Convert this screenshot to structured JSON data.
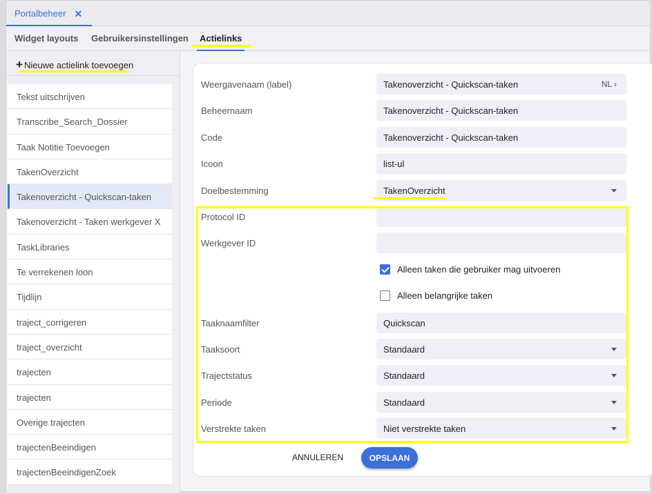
{
  "tab": {
    "title": "Portalbeheer",
    "close": "✕"
  },
  "subtabs": [
    "Widget layouts",
    "Gebruikersinstellingen",
    "Actielinks"
  ],
  "sidebar": {
    "add_label": "Nieuwe actielink toevoegen",
    "items": [
      "Tekst uitschrijven",
      "Transcribe_Search_Dossier",
      "Taak Notitie Toevoegen",
      "TakenOverzicht",
      "Takenoverzicht - Quickscan-taken",
      "Takenoverzicht - Taken werkgever X",
      "TaskLibraries",
      "Te verrekenen loon",
      "Tijdlijn",
      "traject_corrigeren",
      "traject_overzicht",
      "trajecten",
      "trajecten",
      "Overige trajecten",
      "trajectenBeeindigen",
      "trajectenBeeindigenZoek"
    ],
    "selected_index": 4
  },
  "form": {
    "display_name": {
      "label": "Weergavenaam (label)",
      "value": "Takenoverzicht - Quickscan-taken",
      "lang": "NL ›"
    },
    "admin_name": {
      "label": "Beheernaam",
      "value": "Takenoverzicht - Quickscan-taken"
    },
    "code": {
      "label": "Code",
      "value": "Takenoverzicht - Quickscan-taken"
    },
    "icon": {
      "label": "Icoon",
      "value": "list-ul"
    },
    "destination": {
      "label": "Doelbestemming",
      "value": "TakenOverzicht"
    },
    "protocol_id": {
      "label": "Protocol ID",
      "value": ""
    },
    "employer_id": {
      "label": "Werkgever ID",
      "value": ""
    },
    "only_allowed": {
      "label": "Alleen taken die gebruiker mag uitvoeren",
      "checked": true
    },
    "only_important": {
      "label": "Alleen belangrijke taken",
      "checked": false
    },
    "task_name_filter": {
      "label": "Taaknaamfilter",
      "value": "Quickscan"
    },
    "task_type": {
      "label": "Taaksoort",
      "value": "Standaard"
    },
    "trajectory_status": {
      "label": "Trajectstatus",
      "value": "Standaard"
    },
    "period": {
      "label": "Periode",
      "value": "Standaard"
    },
    "expired_tasks": {
      "label": "Verstrekte taken",
      "value": "Niet verstrekte taken"
    }
  },
  "buttons": {
    "cancel": "ANNULEREN",
    "save": "OPSLAAN"
  },
  "colors": {
    "accent": "#3b6fd9",
    "highlight": "#ffff00"
  }
}
